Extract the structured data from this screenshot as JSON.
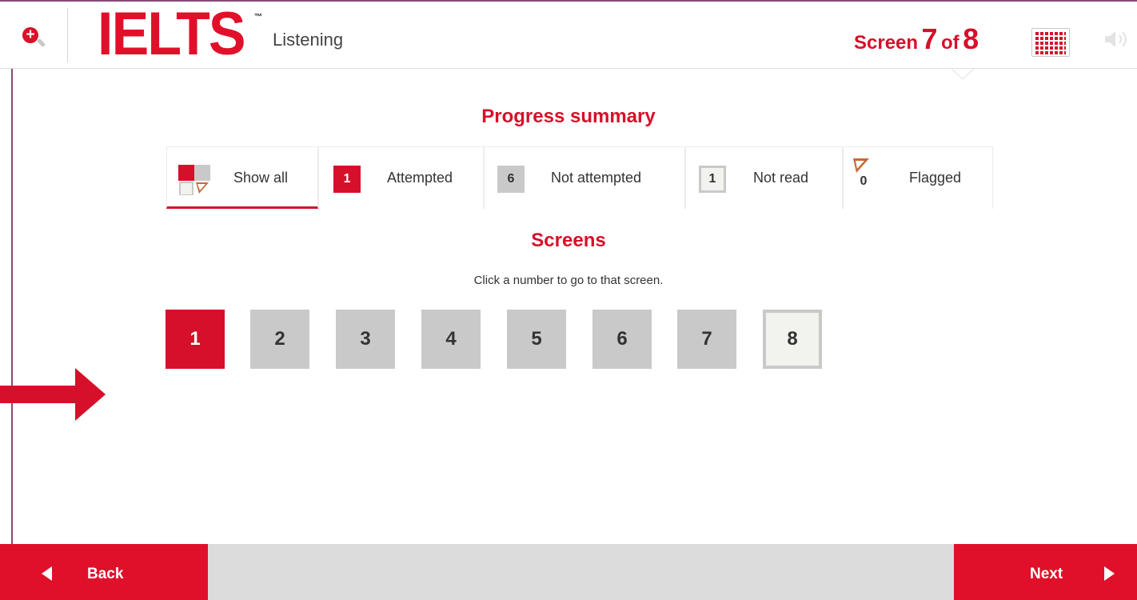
{
  "header": {
    "logo": "IELTS",
    "trademark": "™",
    "section": "Listening",
    "screen_prefix": "Screen",
    "screen_current": "7",
    "screen_of": "of",
    "screen_total": "8"
  },
  "icons": {
    "zoom": "zoom-in-icon",
    "grid": "screen-grid-icon",
    "volume": "volume-icon",
    "arrow": "red-arrow-icon"
  },
  "progress": {
    "title": "Progress summary",
    "tabs": [
      {
        "label": "Show all",
        "count": ""
      },
      {
        "label": "Attempted",
        "count": "1"
      },
      {
        "label": "Not attempted",
        "count": "6"
      },
      {
        "label": "Not read",
        "count": "1"
      },
      {
        "label": "Flagged",
        "count": "0"
      }
    ],
    "active_tab": "Show all"
  },
  "screens": {
    "title": "Screens",
    "instruction": "Click a number to go to that screen.",
    "items": [
      {
        "number": "1",
        "status": "attempted"
      },
      {
        "number": "2",
        "status": "not-attempted"
      },
      {
        "number": "3",
        "status": "not-attempted"
      },
      {
        "number": "4",
        "status": "not-attempted"
      },
      {
        "number": "5",
        "status": "not-attempted"
      },
      {
        "number": "6",
        "status": "not-attempted"
      },
      {
        "number": "7",
        "status": "not-attempted"
      },
      {
        "number": "8",
        "status": "not-read"
      }
    ]
  },
  "footer": {
    "back_label": "Back",
    "next_label": "Next"
  },
  "colors": {
    "brand_red": "#d6102a",
    "tile_grey": "#c9c9c9",
    "footer_grey": "#dcdcdc"
  }
}
